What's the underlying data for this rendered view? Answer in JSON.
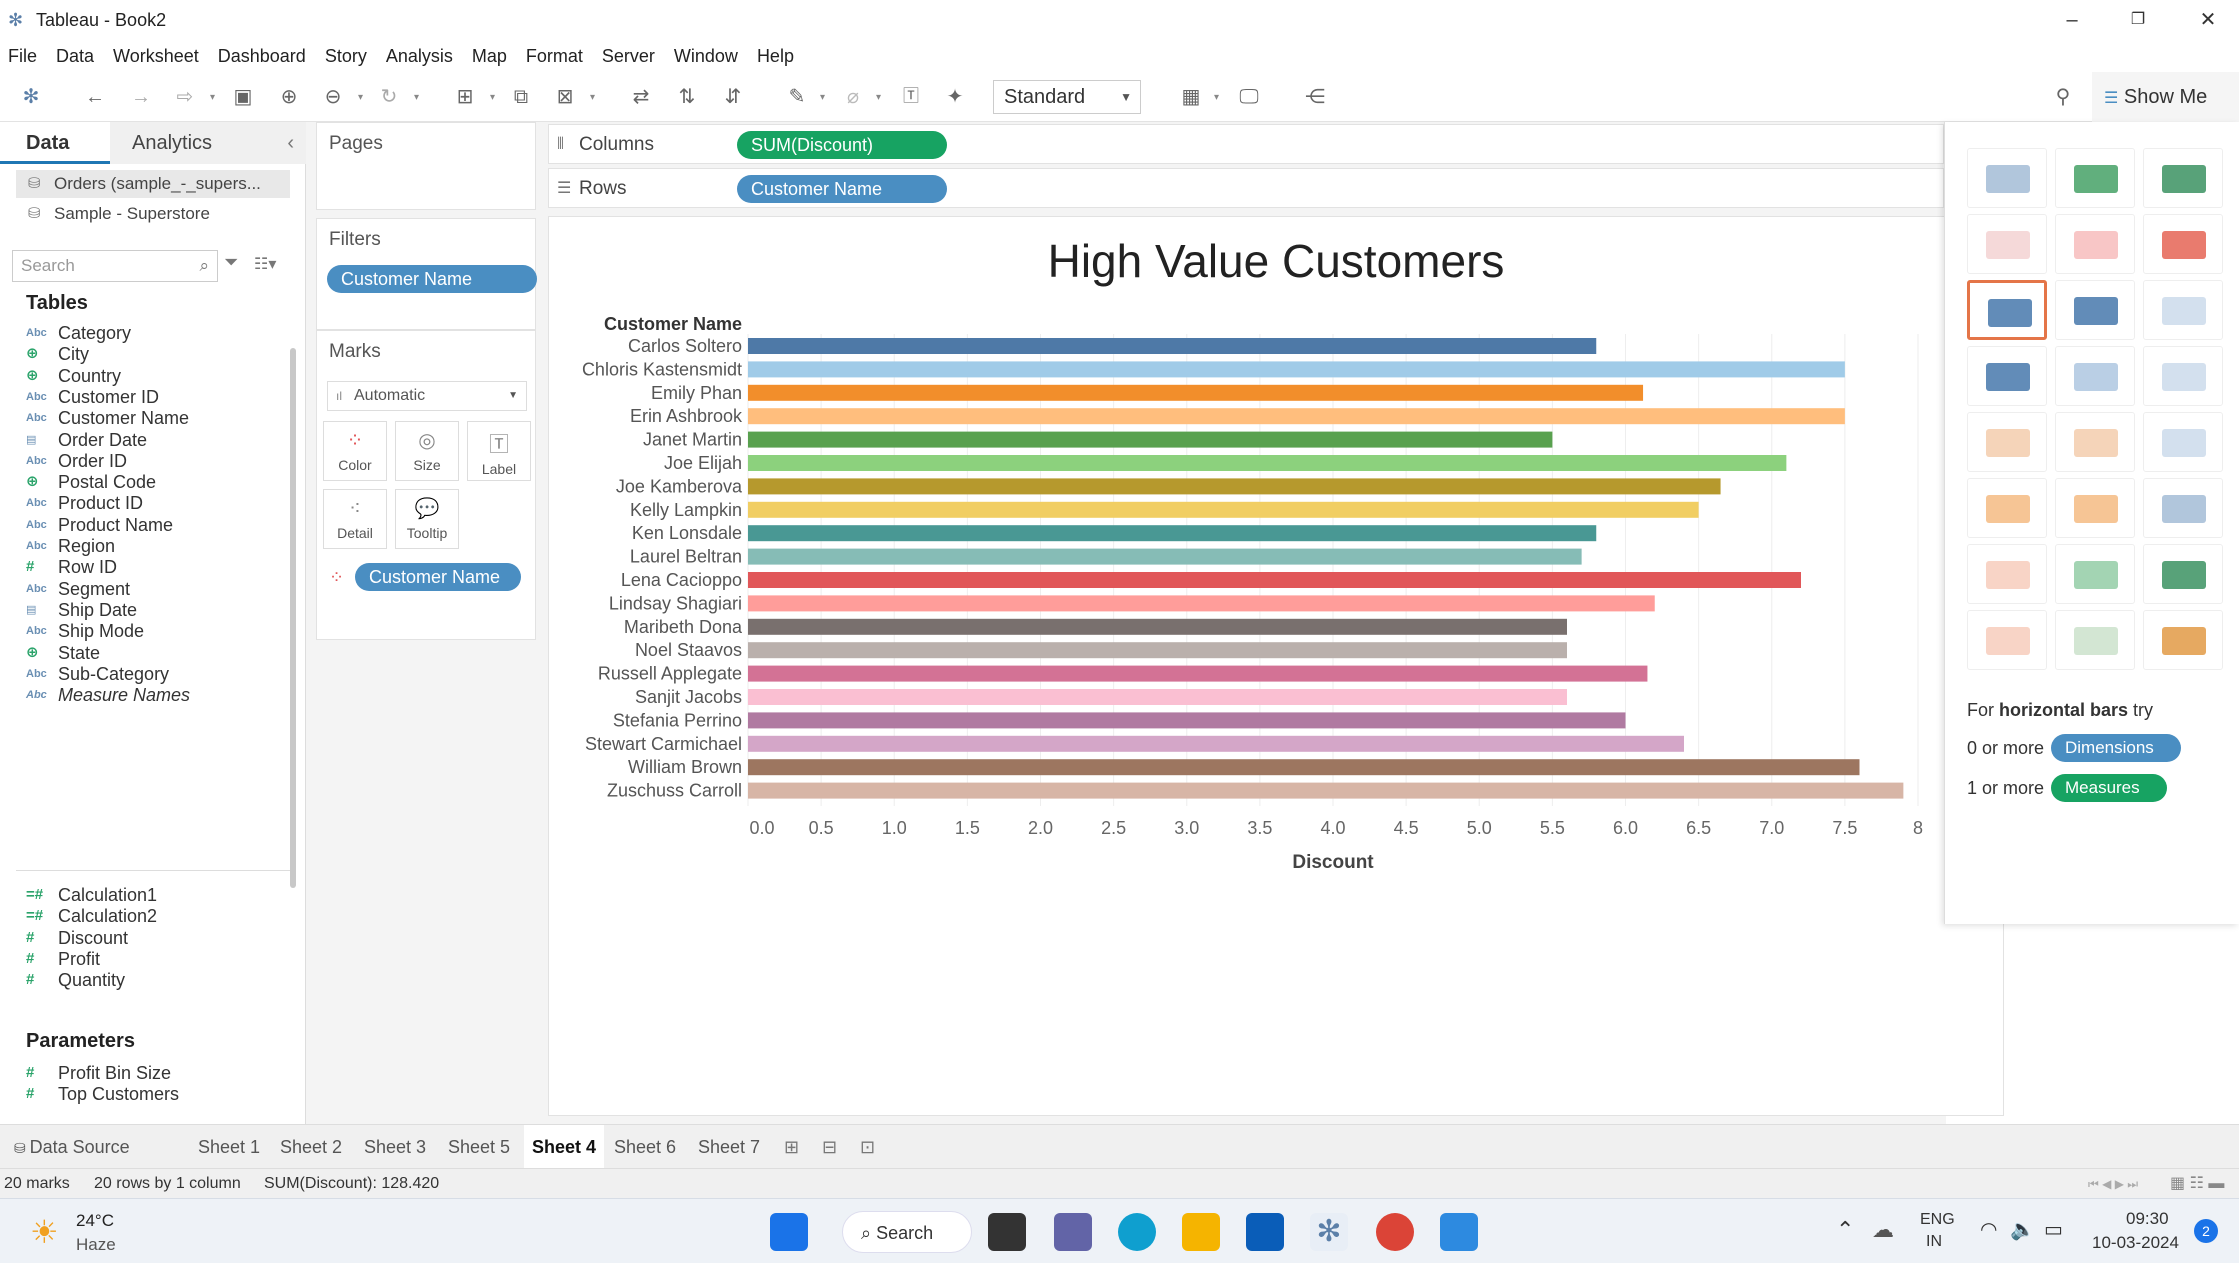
{
  "window": {
    "title": "Tableau - Book2"
  },
  "menu": [
    "File",
    "Data",
    "Worksheet",
    "Dashboard",
    "Story",
    "Analysis",
    "Map",
    "Format",
    "Server",
    "Window",
    "Help"
  ],
  "toolbar": {
    "fit": "Standard",
    "show_me": "Show Me"
  },
  "data_pane": {
    "tab_data": "Data",
    "tab_analytics": "Analytics",
    "sources": [
      "Orders (sample_-_supers...",
      "Sample - Superstore"
    ],
    "search_placeholder": "Search",
    "tables_heading": "Tables",
    "dimensions": [
      {
        "type": "Abc",
        "name": "Category"
      },
      {
        "type": "globe",
        "name": "City"
      },
      {
        "type": "globe",
        "name": "Country"
      },
      {
        "type": "Abc",
        "name": "Customer ID"
      },
      {
        "type": "Abc",
        "name": "Customer Name"
      },
      {
        "type": "date",
        "name": "Order Date"
      },
      {
        "type": "Abc",
        "name": "Order ID"
      },
      {
        "type": "globe",
        "name": "Postal Code"
      },
      {
        "type": "Abc",
        "name": "Product ID"
      },
      {
        "type": "Abc",
        "name": "Product Name"
      },
      {
        "type": "Abc",
        "name": "Region"
      },
      {
        "type": "#",
        "name": "Row ID"
      },
      {
        "type": "Abc",
        "name": "Segment"
      },
      {
        "type": "date",
        "name": "Ship Date"
      },
      {
        "type": "Abc",
        "name": "Ship Mode"
      },
      {
        "type": "globe",
        "name": "State"
      },
      {
        "type": "Abc",
        "name": "Sub-Category"
      },
      {
        "type": "Abc",
        "name": "Measure Names"
      }
    ],
    "measures": [
      {
        "type": "=#",
        "name": "Calculation1"
      },
      {
        "type": "=#",
        "name": "Calculation2"
      },
      {
        "type": "#",
        "name": "Discount"
      },
      {
        "type": "#",
        "name": "Profit"
      },
      {
        "type": "#",
        "name": "Quantity"
      }
    ],
    "parameters_heading": "Parameters",
    "parameters": [
      {
        "type": "#",
        "name": "Profit Bin Size"
      },
      {
        "type": "#",
        "name": "Top Customers"
      }
    ]
  },
  "shelves": {
    "pages_label": "Pages",
    "filters_label": "Filters",
    "filter_pill": "Customer Name",
    "marks_label": "Marks",
    "mark_type": "Automatic",
    "mark_buttons": [
      "Color",
      "Size",
      "Label",
      "Detail",
      "Tooltip"
    ],
    "mark_pill": "Customer Name",
    "columns_label": "Columns",
    "columns_pill": "SUM(Discount)",
    "rows_label": "Rows",
    "rows_pill": "Customer Name"
  },
  "chart_data": {
    "type": "bar",
    "orientation": "horizontal",
    "title": "High Value Customers",
    "category_header": "Customer Name",
    "xlabel": "Discount",
    "xlim": [
      0,
      8
    ],
    "xticks": [
      0.0,
      0.5,
      1.0,
      1.5,
      2.0,
      2.5,
      3.0,
      3.5,
      4.0,
      4.5,
      5.0,
      5.5,
      6.0,
      6.5,
      7.0,
      7.5,
      8
    ],
    "grid": true,
    "categories": [
      "Carlos Soltero",
      "Chloris Kastensmidt",
      "Emily Phan",
      "Erin Ashbrook",
      "Janet Martin",
      "Joe Elijah",
      "Joe Kamberova",
      "Kelly Lampkin",
      "Ken Lonsdale",
      "Laurel Beltran",
      "Lena Cacioppo",
      "Lindsay Shagiari",
      "Maribeth Dona",
      "Noel Staavos",
      "Russell Applegate",
      "Sanjit Jacobs",
      "Stefania Perrino",
      "Stewart Carmichael",
      "William Brown",
      "Zuschuss Carroll"
    ],
    "values": [
      5.8,
      7.5,
      6.12,
      7.5,
      5.5,
      7.1,
      6.65,
      6.5,
      5.8,
      5.7,
      7.2,
      6.2,
      5.6,
      5.6,
      6.15,
      5.6,
      6.0,
      6.4,
      7.6,
      7.9
    ],
    "colors": [
      "#4e79a7",
      "#a0cbe8",
      "#f28e2b",
      "#ffbe7d",
      "#59a14f",
      "#8cd17d",
      "#b6992d",
      "#f1ce63",
      "#499894",
      "#86bcb6",
      "#e15759",
      "#ff9d9a",
      "#79706e",
      "#bab0ac",
      "#d37295",
      "#fabfd2",
      "#b07aa1",
      "#d4a6c8",
      "#9d7660",
      "#d7b5a6"
    ]
  },
  "show_me": {
    "hint_prefix": "For",
    "hint_bold": "horizontal bars",
    "hint_suffix": "try",
    "dim_prefix": "0 or more",
    "dim_pill": "Dimensions",
    "meas_prefix": "1 or more",
    "meas_pill": "Measures"
  },
  "sheet_tabs": [
    "Data Source",
    "Sheet 1",
    "Sheet 2",
    "Sheet 3",
    "Sheet 5",
    "Sheet 4",
    "Sheet 6",
    "Sheet 7"
  ],
  "active_sheet": "Sheet 4",
  "status": {
    "marks": "20 marks",
    "rows": "20 rows by 1 column",
    "sum": "SUM(Discount): 128.420"
  },
  "taskbar": {
    "weather_temp": "24°C",
    "weather_desc": "Haze",
    "search_label": "Search",
    "lang_top": "ENG",
    "lang_bottom": "IN",
    "time": "09:30",
    "date": "10-03-2024",
    "notif_count": "2"
  },
  "colors": {
    "blue_pill": "#4a8ec2",
    "green_pill": "#17a362",
    "accent": "#1f77b4"
  }
}
